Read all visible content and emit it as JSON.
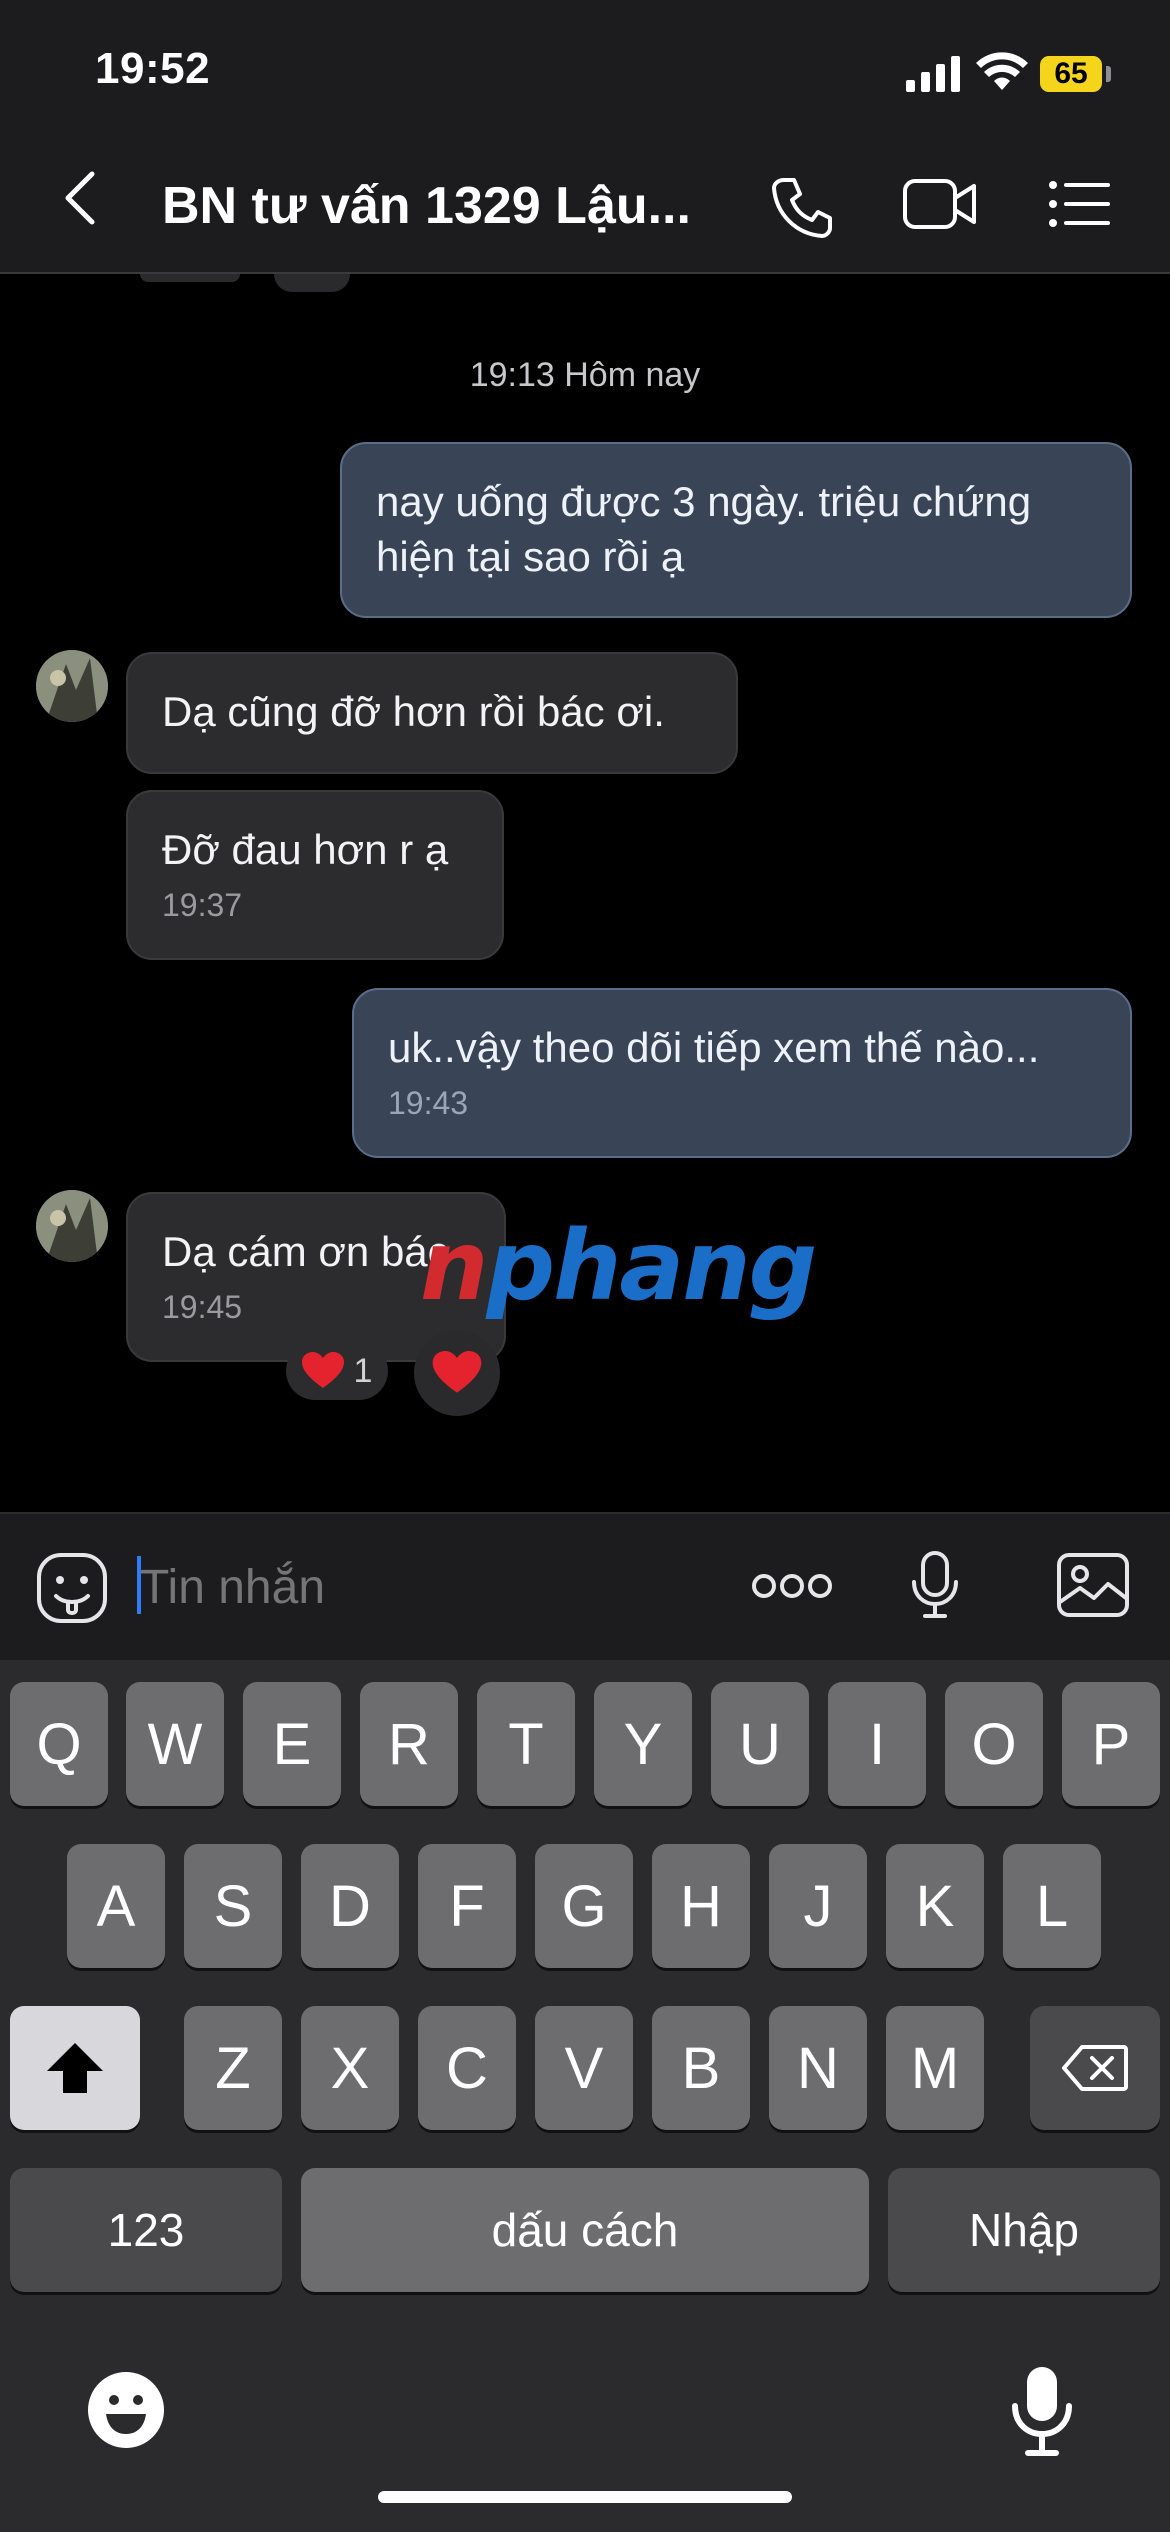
{
  "status_bar": {
    "time": "19:52",
    "battery": "65"
  },
  "header": {
    "title": "BN tư vấn 1329 Lậu...",
    "icons": [
      "chevron-left-icon",
      "phone-icon",
      "video-camera-icon",
      "list-menu-icon"
    ]
  },
  "conversation": {
    "date_separator": "19:13 Hôm nay",
    "messages": [
      {
        "direction": "outgoing",
        "text": "nay uống được 3 ngày. triệu chứng hiện tại sao rồi ạ",
        "time": ""
      },
      {
        "direction": "incoming",
        "text": "Dạ cũng đỡ hơn rồi bác ơi.",
        "time": ""
      },
      {
        "direction": "incoming",
        "text": "Đỡ đau hơn r ạ",
        "time": "19:37"
      },
      {
        "direction": "outgoing",
        "text": "uk..vậy theo dõi tiếp xem thế nào...",
        "time": "19:43"
      },
      {
        "direction": "incoming",
        "text": "Dạ cám ơn bác",
        "time": "19:45"
      }
    ],
    "reaction": {
      "icon": "heart-icon",
      "count": "1"
    }
  },
  "watermark": {
    "part1": "n",
    "part2": "phang"
  },
  "composer": {
    "placeholder": "Tin nhắn",
    "icons": [
      "sticker-icon",
      "more-dots-icon",
      "microphone-icon",
      "image-icon"
    ]
  },
  "keyboard": {
    "row1": [
      "Q",
      "W",
      "E",
      "R",
      "T",
      "Y",
      "U",
      "I",
      "O",
      "P"
    ],
    "row2": [
      "A",
      "S",
      "D",
      "F",
      "G",
      "H",
      "J",
      "K",
      "L"
    ],
    "row3": [
      "Z",
      "X",
      "C",
      "V",
      "B",
      "N",
      "M"
    ],
    "numbers_key": "123",
    "space_key": "dấu cách",
    "return_key": "Nhập"
  },
  "colors": {
    "outgoing_bubble": "#394556",
    "incoming_bubble": "#2c2c2e",
    "accent": "#2f7cf6",
    "heart": "#e5232e"
  }
}
